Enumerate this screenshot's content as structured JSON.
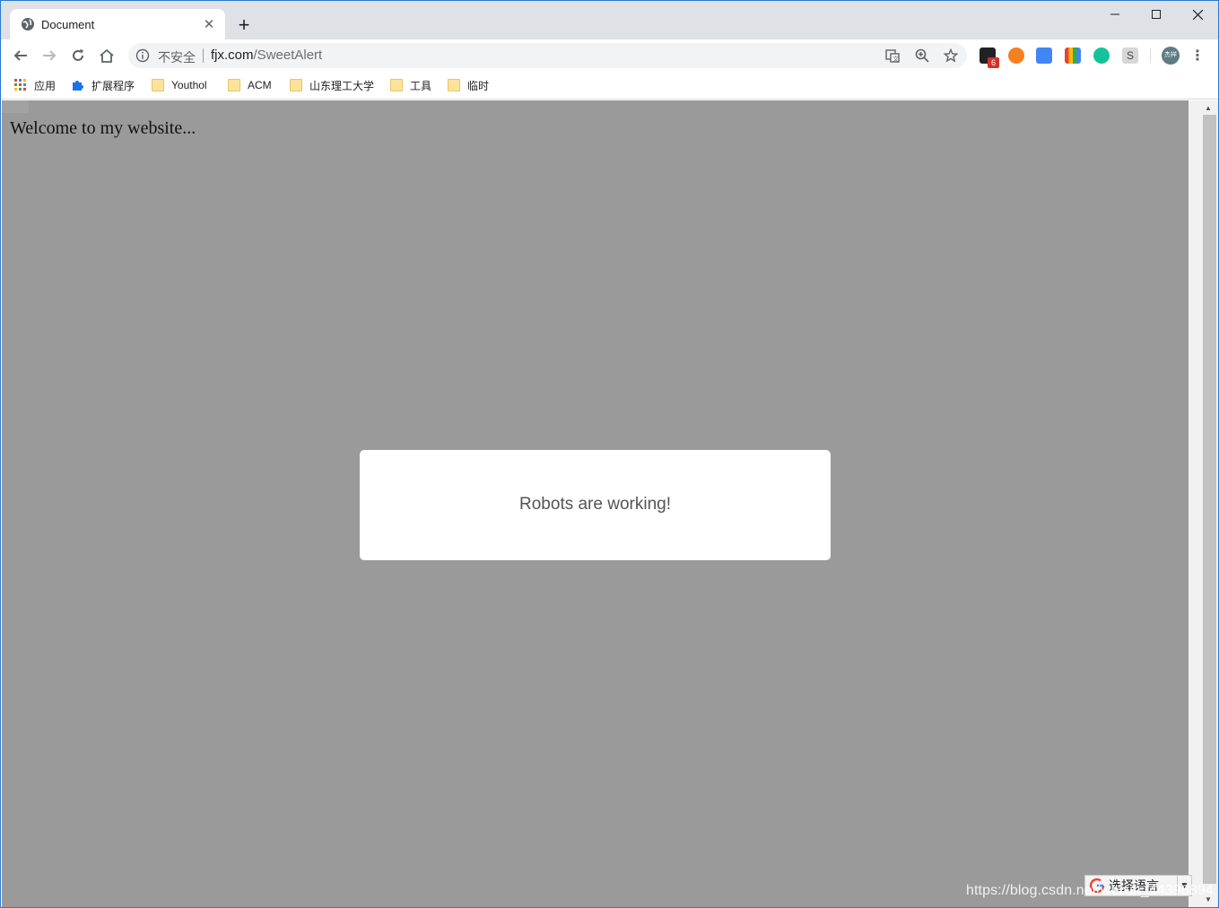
{
  "tab": {
    "title": "Document"
  },
  "window_controls": {
    "minimize": "─",
    "maximize": "☐",
    "close": "✕"
  },
  "omnibox": {
    "security_text": "不安全",
    "host": "fjx.com",
    "path": "/SweetAlert"
  },
  "bookmarks": [
    {
      "label": "应用",
      "icon": "apps-grid-icon"
    },
    {
      "label": "扩展程序",
      "icon": "puzzle-icon"
    },
    {
      "label": "Youthol",
      "icon": "folder-icon"
    },
    {
      "label": "ACM",
      "icon": "folder-icon"
    },
    {
      "label": "山东理工大学",
      "icon": "folder-icon"
    },
    {
      "label": "工具",
      "icon": "folder-icon"
    },
    {
      "label": "临时",
      "icon": "folder-icon"
    }
  ],
  "extensions": {
    "badge_count": "6",
    "profile_initials": "杰祥"
  },
  "page": {
    "welcome_text": "Welcome to my website...",
    "dialog_text": "Robots are working!"
  },
  "translate_widget": {
    "label": "选择语言"
  },
  "watermark": "https://blog.csdn.net/weixin_44396894",
  "colors": {
    "overlay": "#9a9a9a",
    "tabstrip": "#dee1e6",
    "omnibox": "#f1f3f4"
  }
}
